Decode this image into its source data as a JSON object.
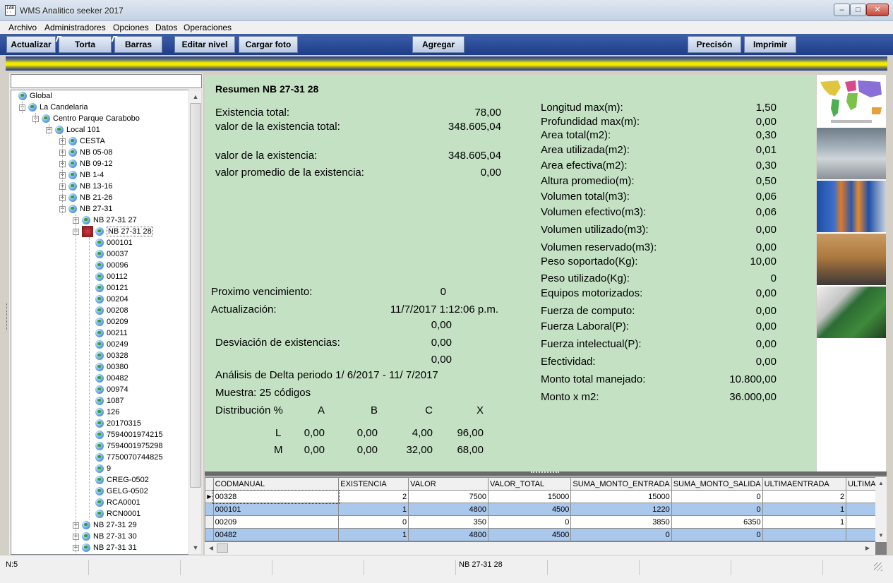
{
  "window": {
    "title": "WMS Analitico seeker 2017",
    "minimize": "–",
    "maximize": "□",
    "close": "✕",
    "icon_text": "IAB ·· ·· ··"
  },
  "menu": [
    "Archivo",
    "Administradores",
    "Opciones",
    "Datos",
    "Operaciones"
  ],
  "toolbar": {
    "actualizar": "Actualizar",
    "torta": "Torta",
    "barras": "Barras",
    "editar_nivel": "Editar nivel",
    "cargar_foto": "Cargar foto",
    "agregar": "Agregar",
    "precision": "Precisón",
    "imprimir": "Imprimir"
  },
  "tree": {
    "search_value": "",
    "nodes": [
      {
        "label": "Global",
        "expander": ""
      },
      {
        "label": "La Candelaria",
        "expander": "−"
      },
      {
        "label": "Centro Parque Carabobo",
        "expander": "−"
      },
      {
        "label": "Local 101",
        "expander": "−"
      },
      {
        "label": "CESTA",
        "expander": "+"
      },
      {
        "label": "NB 05-08",
        "expander": "+"
      },
      {
        "label": "NB 09-12",
        "expander": "+"
      },
      {
        "label": "NB 1-4",
        "expander": "+"
      },
      {
        "label": "NB 13-16",
        "expander": "+"
      },
      {
        "label": "NB 21-26",
        "expander": "+"
      },
      {
        "label": "NB 27-31",
        "expander": "−"
      },
      {
        "label": "NB 27-31 27",
        "expander": "+"
      },
      {
        "label": "NB 27-31 28",
        "expander": "−"
      },
      {
        "label": "000101",
        "expander": ""
      },
      {
        "label": "00037",
        "expander": ""
      },
      {
        "label": "00096",
        "expander": ""
      },
      {
        "label": "00112",
        "expander": ""
      },
      {
        "label": "00121",
        "expander": ""
      },
      {
        "label": "00204",
        "expander": ""
      },
      {
        "label": "00208",
        "expander": ""
      },
      {
        "label": "00209",
        "expander": ""
      },
      {
        "label": "00211",
        "expander": ""
      },
      {
        "label": "00249",
        "expander": ""
      },
      {
        "label": "00328",
        "expander": ""
      },
      {
        "label": "00380",
        "expander": ""
      },
      {
        "label": "00482",
        "expander": ""
      },
      {
        "label": "00974",
        "expander": ""
      },
      {
        "label": "1087",
        "expander": ""
      },
      {
        "label": "126",
        "expander": ""
      },
      {
        "label": "20170315",
        "expander": ""
      },
      {
        "label": "7594001974215",
        "expander": ""
      },
      {
        "label": "7594001975298",
        "expander": ""
      },
      {
        "label": "7750070744825",
        "expander": ""
      },
      {
        "label": "9",
        "expander": ""
      },
      {
        "label": "CREG-0502",
        "expander": ""
      },
      {
        "label": "GELG-0502",
        "expander": ""
      },
      {
        "label": "RCA0001",
        "expander": ""
      },
      {
        "label": "RCN0001",
        "expander": ""
      },
      {
        "label": "NB 27-31 29",
        "expander": "+"
      },
      {
        "label": "NB 27-31 30",
        "expander": "+"
      },
      {
        "label": "NB 27-31 31",
        "expander": "+"
      }
    ]
  },
  "summary": {
    "title": "Resumen NB 27-31 28",
    "existencia_total_label": "Existencia total:",
    "existencia_total": "78,00",
    "valor_existencia_total_label": "valor de la existencia total:",
    "valor_existencia_total": "348.605,04",
    "valor_existencia_label": "valor de la existencia:",
    "valor_existencia": "348.605,04",
    "valor_promedio_label": "valor promedio de la existencia:",
    "valor_promedio": "0,00",
    "proximo_vencimiento_label": "Proximo vencimiento:",
    "proximo_vencimiento": "0",
    "actualizacion_label": "Actualización:",
    "actualizacion": "11/7/2017 1:12:06 p.m.",
    "extra_value_1": "0,00",
    "desviacion_label": "Desviación de existencias:",
    "desviacion": "0,00",
    "extra_value_2": "0,00",
    "analisis": "Análisis de Delta periodo  1/ 6/2017 - 11/ 7/2017",
    "muestra": "Muestra: 25 códigos",
    "distribucion_label": "Distribución %",
    "dist_headers": [
      "A",
      "B",
      "C",
      "X"
    ],
    "dist_rows": [
      {
        "label": "L",
        "values": [
          "0,00",
          "0,00",
          "4,00",
          "96,00"
        ]
      },
      {
        "label": "M",
        "values": [
          "0,00",
          "0,00",
          "32,00",
          "68,00"
        ]
      }
    ],
    "right_metrics": [
      {
        "label": "Longitud  max(m):",
        "value": "1,50"
      },
      {
        "label": "Profundidad max(m):",
        "value": "0,00"
      },
      {
        "label": "Area total(m2):",
        "value": "0,30"
      },
      {
        "label": "Area utilizada(m2):",
        "value": "0,01"
      },
      {
        "label": "Area efectiva(m2):",
        "value": "0,30"
      },
      {
        "label": "Altura promedio(m):",
        "value": "0,50"
      },
      {
        "label": "Volumen total(m3):",
        "value": "0,06"
      },
      {
        "label": "Volumen efectivo(m3):",
        "value": "0,06"
      },
      {
        "label": "Volumen utilizado(m3):",
        "value": "0,00"
      },
      {
        "label": "Volumen reservado(m3):",
        "value": "0,00"
      },
      {
        "label": "Peso soportado(Kg):",
        "value": "10,00"
      },
      {
        "label": "Peso utilizado(Kg):",
        "value": "0"
      },
      {
        "label": "Equipos motorizados:",
        "value": "0,00"
      },
      {
        "label": "Fuerza de computo:",
        "value": "0,00"
      },
      {
        "label": "Fuerza Laboral(P):",
        "value": "0,00"
      },
      {
        "label": "Fuerza intelectual(P):",
        "value": "0,00"
      },
      {
        "label": "Efectividad:",
        "value": "0,00"
      },
      {
        "label": "Monto total manejado:",
        "value": "10.800,00"
      },
      {
        "label": "Monto x m2:",
        "value": "36.000,00"
      }
    ]
  },
  "images": [
    "world-map",
    "warehouse-interior",
    "warehouse-racks",
    "stacked-boxes",
    "circuit-board"
  ],
  "grid": {
    "columns": [
      "CODMANUAL",
      "EXISTENCIA",
      "VALOR",
      "VALOR_TOTAL",
      "SUMA_MONTO_ENTRADA",
      "SUMA_MONTO_SALIDA",
      "ULTIMAENTRADA",
      "ULTIMAS"
    ],
    "rows": [
      [
        "00328",
        "2",
        "7500",
        "15000",
        "15000",
        "0",
        "2",
        ""
      ],
      [
        "000101",
        "1",
        "4800",
        "4500",
        "1220",
        "0",
        "1",
        ""
      ],
      [
        "00209",
        "0",
        "350",
        "0",
        "3850",
        "6350",
        "1",
        ""
      ],
      [
        "00482",
        "1",
        "4800",
        "4500",
        "0",
        "0",
        "",
        ""
      ]
    ],
    "current_row_marker": "▶"
  },
  "status": {
    "count": "N:5",
    "node": "NB 27-31 28"
  },
  "colors": {
    "toolbar": "#1e3c8a",
    "summary_bg": "#c4e1c4",
    "row_alt": "#aac8ec"
  }
}
